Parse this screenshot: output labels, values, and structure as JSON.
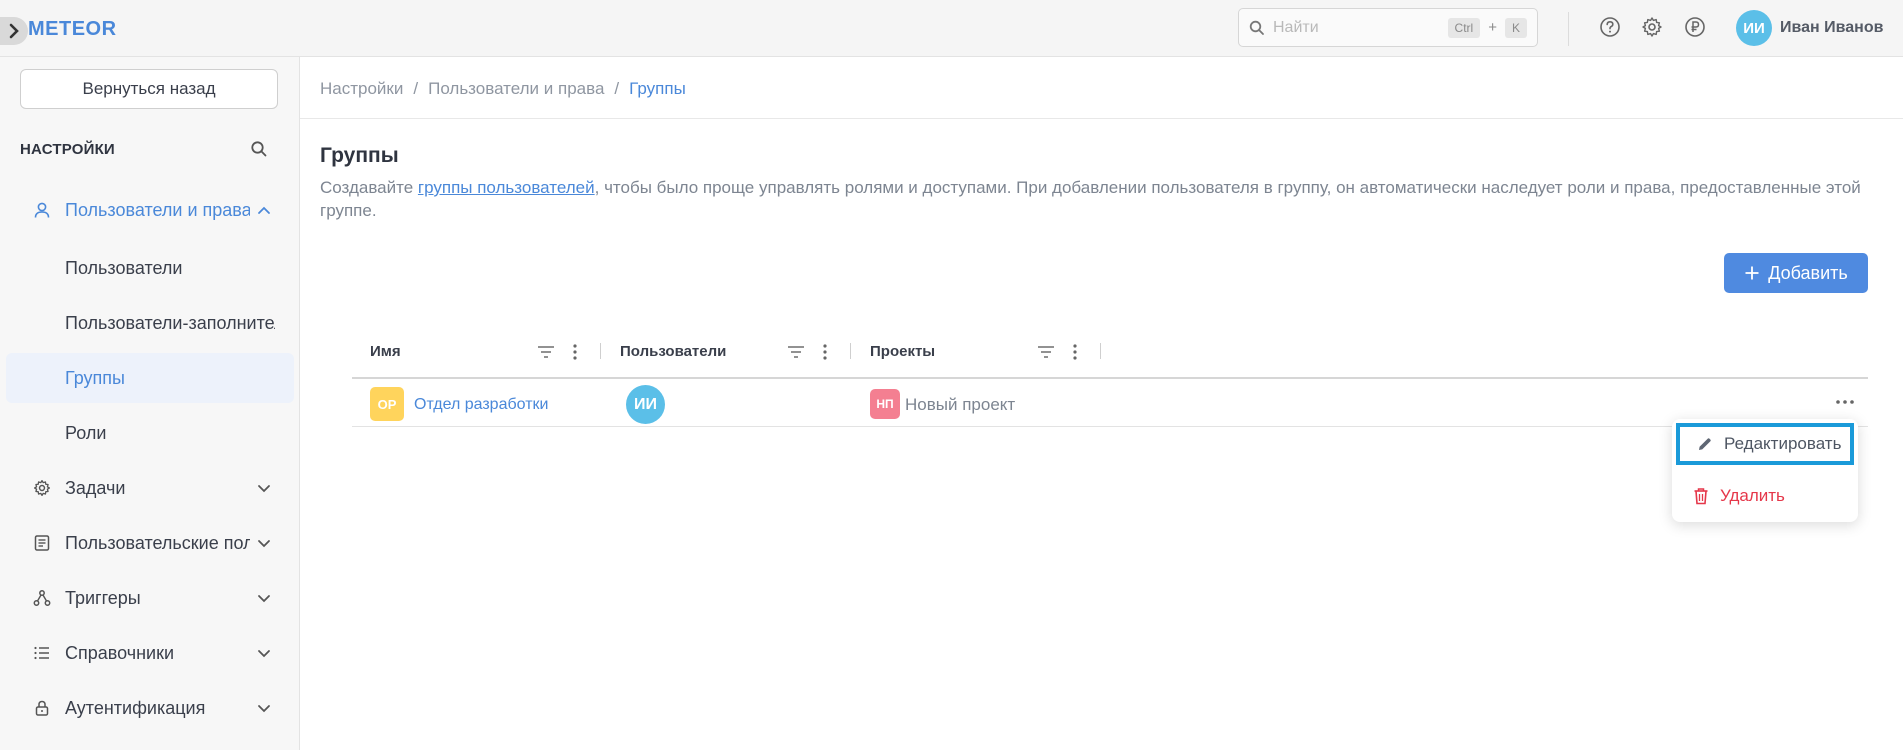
{
  "app": {
    "logo": "METEOR"
  },
  "header": {
    "search_placeholder": "Найти",
    "shortcut_key1": "Ctrl",
    "shortcut_plus": "+",
    "shortcut_key2": "K",
    "icons": [
      "help-icon",
      "gear-icon",
      "currency-icon"
    ],
    "user": {
      "initials": "ИИ",
      "name": "Иван Иванов",
      "avatar_color": "#5bbfe8"
    }
  },
  "sidebar": {
    "back_label": "Вернуться назад",
    "title": "НАСТРОЙКИ",
    "items": [
      {
        "label": "Пользователи и права",
        "icon": "user-icon",
        "expanded": true
      },
      {
        "label": "Задачи",
        "icon": "gear-icon"
      },
      {
        "label": "Пользовательские поля",
        "icon": "list-icon"
      },
      {
        "label": "Триггеры",
        "icon": "trigger-icon"
      },
      {
        "label": "Справочники",
        "icon": "bullet-list-icon"
      },
      {
        "label": "Аутентификация",
        "icon": "lock-icon"
      }
    ],
    "subitems": [
      {
        "label": "Пользователи"
      },
      {
        "label": "Пользователи-заполнители"
      },
      {
        "label": "Группы",
        "selected": true
      },
      {
        "label": "Роли"
      }
    ]
  },
  "breadcrumb": {
    "items": [
      "Настройки",
      "Пользователи и права",
      "Группы"
    ],
    "separator": "/"
  },
  "page": {
    "title": "Группы",
    "desc_before": "Создавайте ",
    "desc_link": "группы пользователей",
    "desc_after": ", чтобы было проще управлять ролями и доступами. При добавлении пользователя в группу, он автоматически наследует роли и права, предоставленные этой группе.",
    "add_label": "Добавить"
  },
  "table": {
    "columns": [
      "Имя",
      "Пользователи",
      "Проекты"
    ],
    "rows": [
      {
        "group_initials": "ОР",
        "group_color": "#ffd45c",
        "group_name": "Отдел разработки",
        "user_initials": "ИИ",
        "user_color": "#5bbfe8",
        "project_initials": "НП",
        "project_color": "#f47f91",
        "project_name": "Новый проект"
      }
    ]
  },
  "context_menu": {
    "edit_label": "Редактировать",
    "delete_label": "Удалить",
    "accent": "#1a9ad9",
    "danger": "#e5374a"
  },
  "colors": {
    "accent": "#4a88d9",
    "primary_button": "#4f8ae0"
  }
}
